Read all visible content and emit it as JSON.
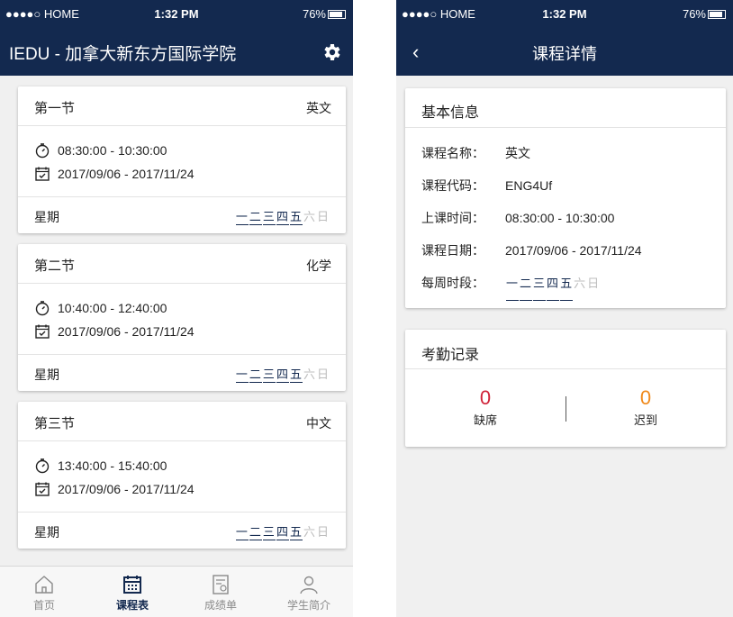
{
  "status": {
    "carrier": "●●●●○ HOME",
    "time": "1:32 PM",
    "battery": "76%"
  },
  "left": {
    "title": "IEDU - 加拿大新东方国际学院",
    "weekday_label": "星期",
    "weekdays": [
      "一",
      "二",
      "三",
      "四",
      "五",
      "六",
      "日"
    ],
    "courses": [
      {
        "period": "第一节",
        "subject": "英文",
        "time": "08:30:00 - 10:30:00",
        "date": "2017/09/06 - 2017/11/24"
      },
      {
        "period": "第二节",
        "subject": "化学",
        "time": "10:40:00 - 12:40:00",
        "date": "2017/09/06 - 2017/11/24"
      },
      {
        "period": "第三节",
        "subject": "中文",
        "time": "13:40:00 - 15:40:00",
        "date": "2017/09/06 - 2017/11/24"
      }
    ],
    "tabs": [
      {
        "label": "首页",
        "icon": "home-icon"
      },
      {
        "label": "课程表",
        "icon": "calendar-icon",
        "active": true
      },
      {
        "label": "成绩单",
        "icon": "report-icon"
      },
      {
        "label": "学生简介",
        "icon": "person-icon"
      }
    ]
  },
  "right": {
    "title": "课程详情",
    "basic": {
      "heading": "基本信息",
      "name_label": "课程名称：",
      "name": "英文",
      "code_label": "课程代码：",
      "code": "ENG4Uf",
      "time_label": "上课时间：",
      "time": "08:30:00 - 10:30:00",
      "date_label": "课程日期：",
      "date": "2017/09/06 - 2017/11/24",
      "weekly_label": "每周时段："
    },
    "attendance": {
      "heading": "考勤记录",
      "absent_count": "0",
      "absent_label": "缺席",
      "late_count": "0",
      "late_label": "迟到"
    }
  },
  "colors": {
    "navy": "#13294f",
    "absent": "#d0243a",
    "late": "#f08a1c",
    "inactive_day": "#bdbdbd"
  }
}
